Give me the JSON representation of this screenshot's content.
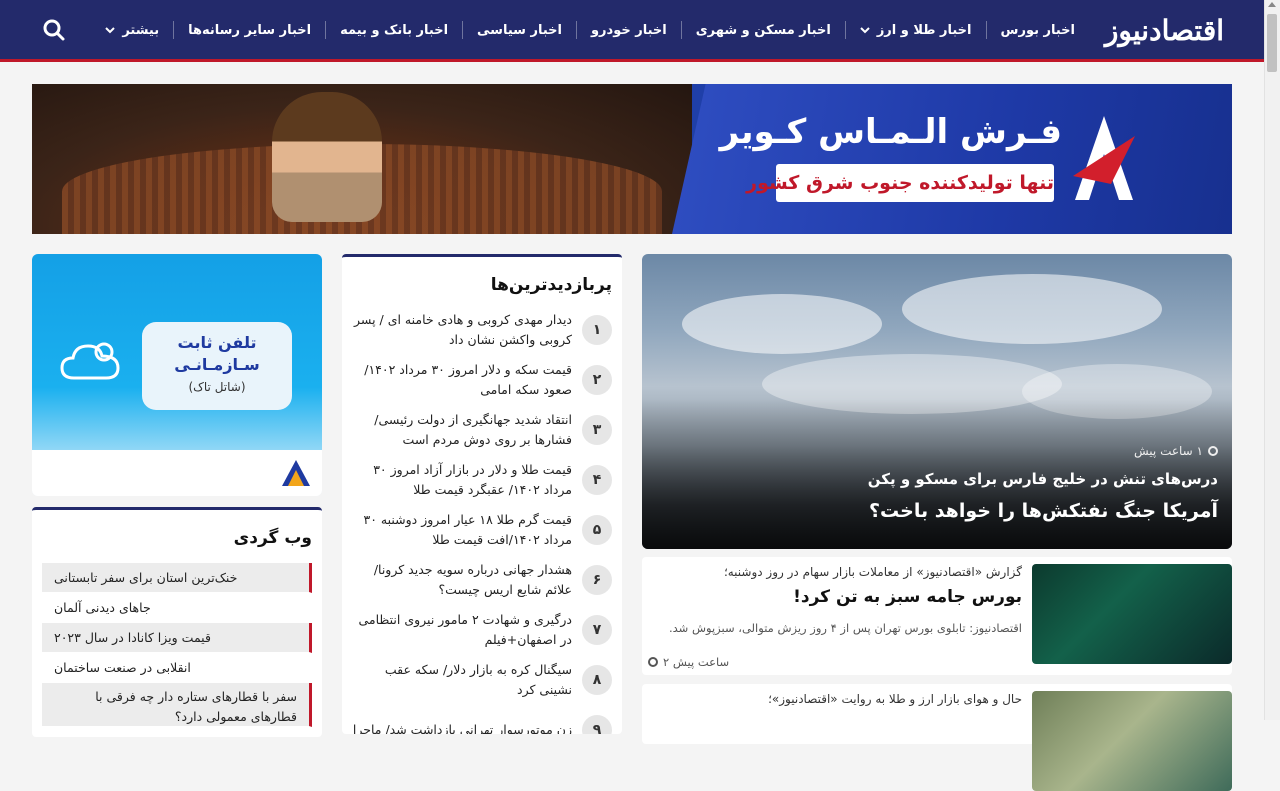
{
  "brand": {
    "logo_text": "اقتصادنیوز",
    "accent": "#c0182a",
    "navy": "#232a6b"
  },
  "nav": {
    "items": [
      {
        "label": "اخبار بورس",
        "has_dropdown": false
      },
      {
        "label": "اخبار طلا و ارز",
        "has_dropdown": true
      },
      {
        "label": "اخبار مسکن و شهری",
        "has_dropdown": false
      },
      {
        "label": "اخبار خودرو",
        "has_dropdown": false
      },
      {
        "label": "اخبار سیاسی",
        "has_dropdown": false
      },
      {
        "label": "اخبار بانک و بیمه",
        "has_dropdown": false
      },
      {
        "label": "اخبار سایر رسانه‌ها",
        "has_dropdown": false
      },
      {
        "label": "بیشتر",
        "has_dropdown": true
      }
    ],
    "search_icon": "search-icon"
  },
  "banner": {
    "title": "فـرش الـمـاس کـویر",
    "tagline": "تنها تولیدکننده جنوب شرق کشور"
  },
  "side_ad": {
    "line1": "تلفن ثابت",
    "line2": "سـازمـانـی",
    "line3": "(شاتل تاک)"
  },
  "web_gardi": {
    "title": "وب گردی",
    "items": [
      "خنک‌ترین استان برای سفر تابستانی",
      "جاهای دیدنی آلمان",
      "قیمت ویزا کانادا در سال ۲۰۲۳",
      "انقلابی در صنعت ساختمان",
      "سفر با قطارهای ستاره دار چه فرقی با قطارهای معمولی دارد؟"
    ]
  },
  "popular": {
    "title": "پربازدیدترین‌ها",
    "items": [
      {
        "num": "۱",
        "text": "دیدار مهدی کروبی و هادی خامنه ای / پسر کروبی واکشن نشان داد"
      },
      {
        "num": "۲",
        "text": "قیمت سکه و دلار امروز ۳۰ مرداد ۱۴۰۲/ صعود سکه امامی"
      },
      {
        "num": "۳",
        "text": "انتقاد شدید جهانگیری از دولت رئیسی/ فشارها بر روی دوش مردم است"
      },
      {
        "num": "۴",
        "text": "قیمت طلا و دلار در بازار آزاد امروز ۳۰ مرداد ۱۴۰۲/ عقبگرد قیمت طلا"
      },
      {
        "num": "۵",
        "text": "قیمت گرم طلا ۱۸ عیار امروز دوشنبه ۳۰ مرداد ۱۴۰۲/افت قیمت طلا"
      },
      {
        "num": "۶",
        "text": "هشدار جهانی درباره سویه جدید کرونا/ علائم شایع اریس چیست؟"
      },
      {
        "num": "۷",
        "text": "درگیری و شهادت ۲ مامور نیروی انتظامی در اصفهان+فیلم"
      },
      {
        "num": "۸",
        "text": "سیگنال کره به بازار دلار/ سکه عقب نشینی کرد"
      },
      {
        "num": "۹",
        "text": "زن موتورسوار تهرانی بازداشت شد/ ماجرا"
      }
    ]
  },
  "lead": {
    "time": "۱ ساعت پیش",
    "subtitle": "درس‌های تنش در خلیج فارس برای مسکو و پکن",
    "title": "آمریکا جنگ نفتکش‌ها را خواهد باخت؟"
  },
  "news": [
    {
      "kicker": "گزارش «اقتصادنیوز» از معاملات بازار سهام در روز دوشنبه؛",
      "title": "بورس جامه سبز به تن کرد!",
      "lead": "اقتصادنیوز: تابلوی بورس تهران پس از ۴ روز ریزش متوالی، سبزپوش شد.",
      "time": "۲ ساعت پیش"
    },
    {
      "kicker": "حال و هوای بازار ارز و طلا به روایت «اقتصادنیوز»؛"
    }
  ]
}
